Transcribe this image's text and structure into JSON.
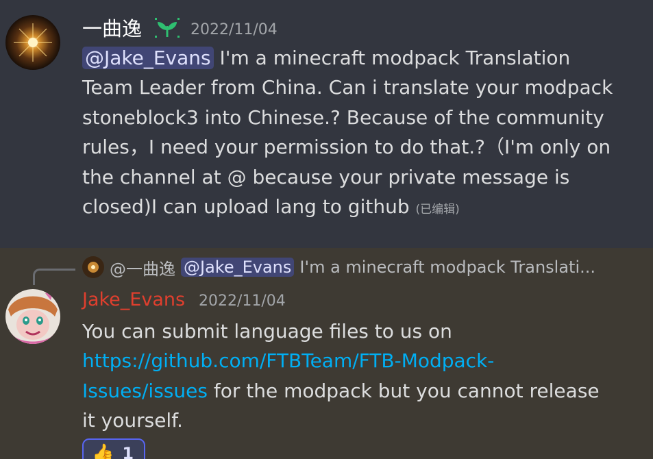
{
  "message_1": {
    "author": "一曲逸",
    "badge_icon": "sprout-icon",
    "timestamp": "2022/11/04",
    "mention": "@Jake_Evans",
    "lines": [
      " I'm a minecraft modpack Translation",
      "Team Leader from China. Can i translate your modpack",
      "stoneblock3 into Chinese.?   Because of the community",
      "rules，I need your permission to do that.?（I'm only on",
      "the channel at @ because your private message is",
      "closed)I can upload lang to github "
    ],
    "edited_label": "(已编辑)"
  },
  "message_2": {
    "reply": {
      "author": "@一曲逸",
      "mention": "@Jake_Evans",
      "preview": "I'm a minecraft modpack Translati..."
    },
    "author": "Jake_Evans",
    "author_color": "#e03f2e",
    "timestamp": "2022/11/04",
    "line_1": "You can submit language files to us on",
    "link_part_1": "https://github.com/FTBTeam/FTB-Modpack-",
    "link_part_2": "Issues/issues",
    "line_3_rest": " for the modpack but you cannot release",
    "line_4": "it yourself.",
    "reaction": {
      "emoji": "thumbs-up-icon",
      "glyph": "👍",
      "count": "1"
    }
  },
  "colors": {
    "mention_bg": "#414675",
    "link": "#00aff4",
    "reaction_border": "#5865f2"
  }
}
